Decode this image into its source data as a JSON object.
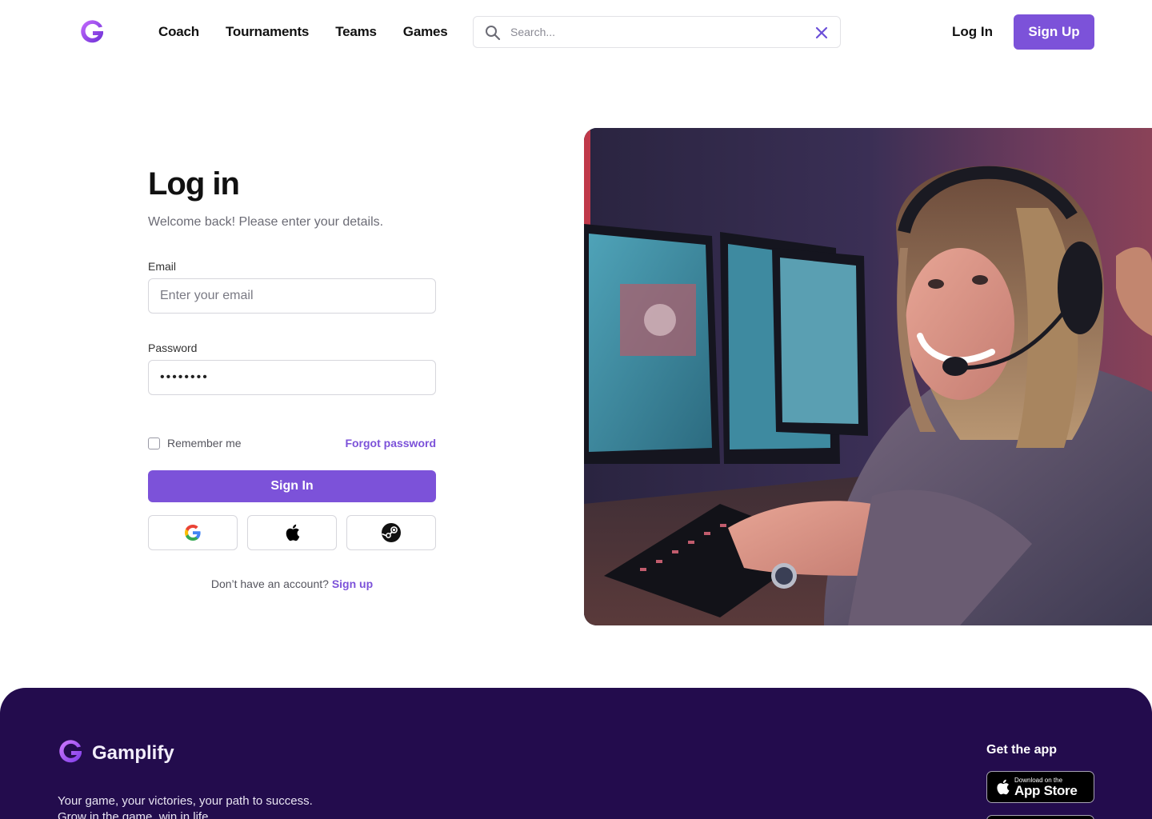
{
  "header": {
    "nav": [
      {
        "label": "Coach"
      },
      {
        "label": "Tournaments"
      },
      {
        "label": "Teams"
      },
      {
        "label": "Games"
      }
    ],
    "search": {
      "placeholder": "Search..."
    },
    "login_label": "Log In",
    "signup_label": "Sign Up"
  },
  "login": {
    "title": "Log in",
    "subtitle": "Welcome back! Please enter your details.",
    "email_label": "Email",
    "email_placeholder": "Enter your email",
    "password_label": "Password",
    "password_value": "••••••••",
    "remember_label": "Remember me",
    "forgot_label": "Forgot password",
    "signin_label": "Sign In",
    "social": [
      {
        "icon": "google-icon"
      },
      {
        "icon": "apple-icon"
      },
      {
        "icon": "steam-icon"
      }
    ],
    "no_account_text": "Don’t have an account?",
    "signup_link": "Sign up"
  },
  "footer": {
    "brand": "Gamplify",
    "tagline_1": "Your game, your victories, your path to success.",
    "tagline_2": "Grow in the game, win in life.",
    "get_app": "Get the app",
    "app_store_small": "Download on the",
    "app_store_big": "App Store"
  },
  "colors": {
    "accent": "#7c52d9",
    "footer_bg": "#230c4d"
  }
}
